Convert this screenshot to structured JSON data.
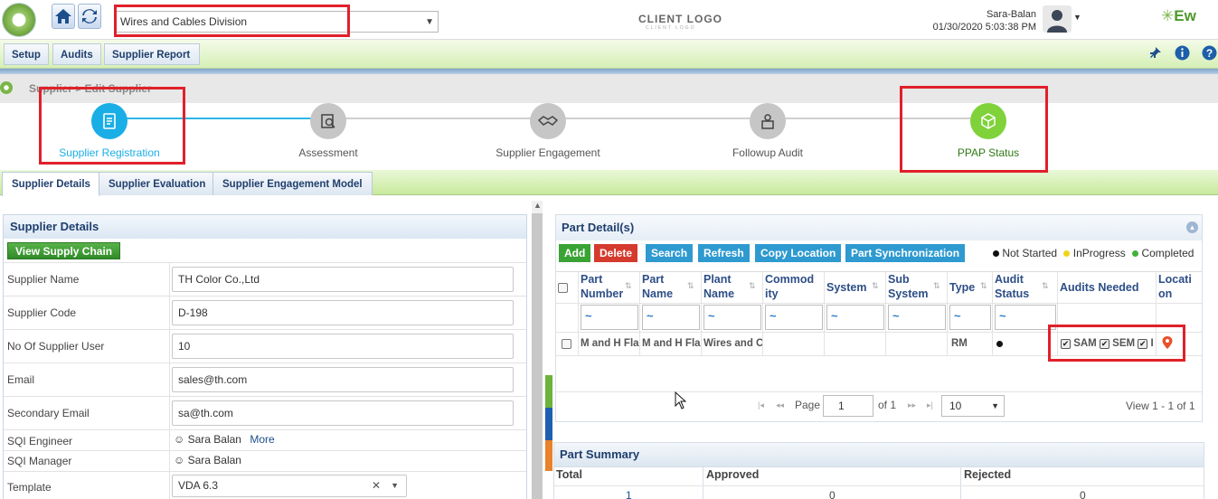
{
  "header": {
    "division": "Wires and Cables Division",
    "client_logo": "CLIENT LOGO",
    "client_logo_sub": "CLIENT LOGO",
    "user_name": "Sara-Balan",
    "datetime": "01/30/2020 5:03:38 PM",
    "brand": "Ew"
  },
  "menu": {
    "items": [
      "Setup",
      "Audits",
      "Supplier Report"
    ]
  },
  "breadcrumb": {
    "text": "Supplier > Edit Supplier"
  },
  "stepper": {
    "steps": [
      "Supplier Registration",
      "Assessment",
      "Supplier Engagement",
      "Followup Audit",
      "PPAP Status"
    ]
  },
  "tabs": [
    "Supplier Details",
    "Supplier Evaluation",
    "Supplier Engagement Model"
  ],
  "supplier_details": {
    "title": "Supplier Details",
    "view_supply_chain": "View Supply Chain",
    "fields": [
      {
        "label": "Supplier Name",
        "value": "TH Color Co.,Ltd"
      },
      {
        "label": "Supplier Code",
        "value": "D-198"
      },
      {
        "label": "No Of Supplier User",
        "value": "10"
      },
      {
        "label": "Email",
        "value": "sales@th.com"
      },
      {
        "label": "Secondary Email",
        "value": "sa@th.com"
      }
    ],
    "sqi_engineer": {
      "label": "SQI Engineer",
      "value": "Sara Balan",
      "more": "More"
    },
    "sqi_manager": {
      "label": "SQI Manager",
      "value": "Sara Balan"
    },
    "template": {
      "label": "Template",
      "value": "VDA 6.3",
      "clear": "✕",
      "caret": "▼"
    }
  },
  "parts": {
    "title": "Part Detail(s)",
    "buttons": {
      "add": "Add",
      "delete": "Delete",
      "search": "Search",
      "refresh": "Refresh",
      "copy_location": "Copy Location",
      "sync": "Part Synchronization"
    },
    "legend": {
      "not_started": "Not Started",
      "in_progress": "InProgress",
      "completed": "Completed"
    },
    "columns": {
      "part_number": [
        "Part",
        "Number"
      ],
      "part_name": [
        "Part",
        "Name"
      ],
      "plant_name": [
        "Plant",
        "Name"
      ],
      "commodity": [
        "Commod",
        "ity"
      ],
      "system": "System",
      "sub_system": [
        "Sub",
        "System"
      ],
      "type": "Type",
      "audit_status": [
        "Audit",
        "Status"
      ],
      "audits_needed": "Audits Needed",
      "location": [
        "Locati",
        "on"
      ]
    },
    "filter": "~",
    "row": {
      "part_number": "M and H Fla",
      "part_name": "M and H Fla",
      "plant_name": "Wires and C",
      "type": "RM",
      "aud1": "SAM",
      "aud2": "SEM",
      "aud3": "I"
    },
    "pager": {
      "page_label": "Page",
      "page_value": "1",
      "of": "of 1",
      "page_size": "10",
      "view": "View 1 - 1 of 1"
    }
  },
  "summary": {
    "title": "Part Summary",
    "total": "Total",
    "approved": "Approved",
    "rejected": "Rejected",
    "total_val": "1",
    "approved_val": "0",
    "rejected_val": "0"
  }
}
